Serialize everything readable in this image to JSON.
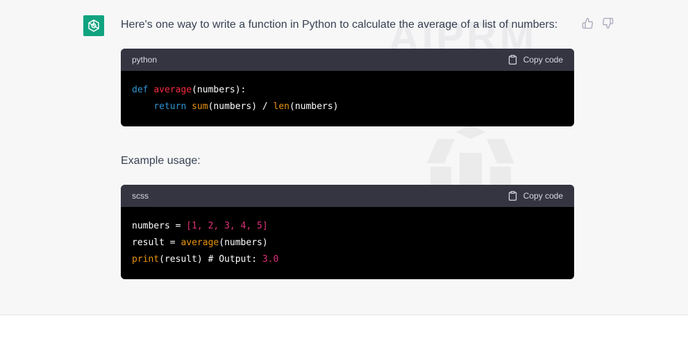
{
  "message": {
    "intro_text": "Here's one way to write a function in Python to calculate the average of a list of numbers:",
    "example_label": "Example usage:"
  },
  "watermark": {
    "text": "AIPRM"
  },
  "code_blocks": [
    {
      "language": "python",
      "copy_label": "Copy code",
      "lines": [
        [
          "def",
          " ",
          "average",
          "(numbers):"
        ],
        [
          "    ",
          "return",
          " ",
          "sum",
          "(numbers) / ",
          "len",
          "(numbers)"
        ]
      ]
    },
    {
      "language": "scss",
      "copy_label": "Copy code",
      "lines": [
        [
          "numbers = ",
          "[1, 2, 3, 4, 5]"
        ],
        [
          "result = ",
          "average",
          "(numbers)"
        ],
        [
          "print",
          "(result) # Output: ",
          "3.0"
        ]
      ]
    }
  ],
  "colors": {
    "avatar_bg": "#10a37f",
    "code_bg": "#000000",
    "code_header_bg": "#343541",
    "keyword": "#2e95d3",
    "function": "#f22c3d",
    "builtin": "#e9950c",
    "number": "#df3079"
  },
  "icons": [
    "openai-logo-icon",
    "thumbs-up-icon",
    "thumbs-down-icon",
    "clipboard-icon"
  ]
}
